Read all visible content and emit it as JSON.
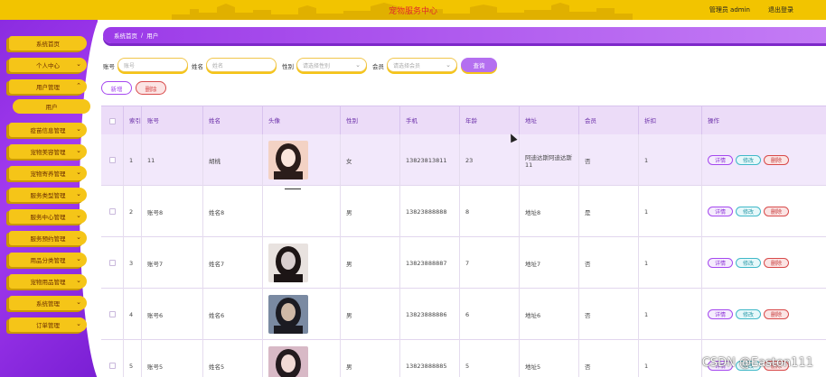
{
  "header": {
    "title": "宠物服务中心",
    "user_label": "管理员 admin",
    "logout_label": "退出登录",
    "bg_color": "#f2c400"
  },
  "sidebar": {
    "items": [
      {
        "label": "系统首页",
        "chevron": false
      },
      {
        "label": "个人中心",
        "chevron": true
      },
      {
        "label": "用户管理",
        "chevron": true,
        "expanded": true
      },
      {
        "label": "用户",
        "sub": true
      },
      {
        "label": "疫苗信息管理",
        "chevron": true
      },
      {
        "label": "宠物美容管理",
        "chevron": true
      },
      {
        "label": "宠物寄养管理",
        "chevron": true
      },
      {
        "label": "服务类型管理",
        "chevron": true
      },
      {
        "label": "服务中心管理",
        "chevron": true
      },
      {
        "label": "服务预约管理",
        "chevron": true
      },
      {
        "label": "用品分类管理",
        "chevron": true
      },
      {
        "label": "宠物用品管理",
        "chevron": true
      },
      {
        "label": "系统管理",
        "chevron": true
      },
      {
        "label": "订单管理",
        "chevron": true
      }
    ]
  },
  "breadcrumb": {
    "home": "系统首页",
    "separator": "/",
    "current": "用户"
  },
  "search": {
    "account_label": "账号",
    "account_placeholder": "账号",
    "name_label": "姓名",
    "name_placeholder": "姓名",
    "gender_label": "性别",
    "gender_placeholder": "请选择性别",
    "member_label": "会员",
    "member_placeholder": "请选择会员",
    "search_button": "查询"
  },
  "actions": {
    "add_button": "新增",
    "delete_button": "删除"
  },
  "table": {
    "headers": [
      "",
      "索引",
      "账号",
      "姓名",
      "头像",
      "性别",
      "手机",
      "年龄",
      "地址",
      "会员",
      "折扣",
      "操作"
    ],
    "rows": [
      {
        "index": "1",
        "account": "11",
        "name": "胡桃",
        "avatar": true,
        "gender": "女",
        "phone": "13823813811",
        "age": "23",
        "address": "阿迪达斯阿迪达斯11",
        "member": "否",
        "discount": "1"
      },
      {
        "index": "2",
        "account": "账号8",
        "name": "姓名8",
        "avatar": false,
        "gender": "男",
        "phone": "13823888888",
        "age": "8",
        "address": "地址8",
        "member": "是",
        "discount": "1"
      },
      {
        "index": "3",
        "account": "账号7",
        "name": "姓名7",
        "avatar": true,
        "gender": "男",
        "phone": "13823888887",
        "age": "7",
        "address": "地址7",
        "member": "否",
        "discount": "1"
      },
      {
        "index": "4",
        "account": "账号6",
        "name": "姓名6",
        "avatar": true,
        "gender": "男",
        "phone": "13823888886",
        "age": "6",
        "address": "地址6",
        "member": "否",
        "discount": "1"
      },
      {
        "index": "5",
        "account": "账号5",
        "name": "姓名5",
        "avatar": true,
        "gender": "男",
        "phone": "13823888885",
        "age": "5",
        "address": "地址5",
        "member": "否",
        "discount": "1"
      }
    ],
    "op_detail": "详情",
    "op_edit": "修改",
    "op_delete": "删除"
  },
  "watermark": "CSDN @Easton111",
  "colors": {
    "accent": "#a548ef",
    "sidebar_item": "#f5c518",
    "danger": "#d84a4a",
    "teal": "#40b8c8"
  }
}
